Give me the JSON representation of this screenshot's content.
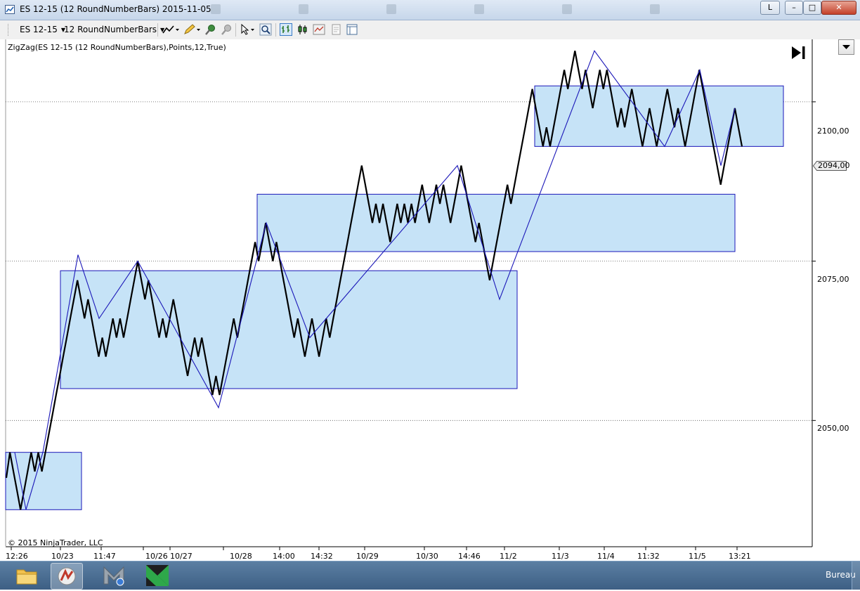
{
  "window": {
    "title": "ES 12-15  (12 RoundNumberBars)  2015-11-05",
    "background_tabs": [
      "",
      "",
      "",
      "",
      "",
      ""
    ],
    "buttons": {
      "l_label": "L",
      "minimize_label": "–",
      "maximize_label": "□",
      "close_label": "✕"
    }
  },
  "toolbar": {
    "instrument": "ES 12-15",
    "interval": "12 RoundNumberBars",
    "icons": [
      "line-drawing-icon",
      "pencil-icon",
      "magnet-icon",
      "crosshair-icon",
      "cursor-icon",
      "zoom-icon",
      "bar-style-icon",
      "candlestick-icon",
      "indicator-icon",
      "properties-icon",
      "layout-icon"
    ]
  },
  "chart": {
    "indicator_label": "ZigZag(ES 12-15 (12 RoundNumberBars),Points,12,True)",
    "copyright": "© 2015 NinjaTrader, LLC",
    "last_price": "2094,00",
    "y_ticks": [
      "2100,00",
      "2075,00",
      "2050,00"
    ],
    "x_ticks": [
      "12:26",
      "10/23",
      "11:47",
      "10/26",
      "10/27",
      "10/28",
      "14:00",
      "14:32",
      "10/29",
      "10/30",
      "14:46",
      "11/2",
      "11/3",
      "11/4",
      "11:32",
      "11/5",
      "13:21"
    ],
    "colors": {
      "price_line": "#000000",
      "zigzag_line": "#1b17b8",
      "box_fill": "#c6e3f7",
      "box_border": "#1b17b8",
      "grid": "#555555"
    }
  },
  "chart_data": {
    "type": "line",
    "title": "",
    "xlabel": "",
    "ylabel": "",
    "ylim": [
      2030.3,
      2109.8
    ],
    "y_ticks": [
      2100,
      2075,
      2050
    ],
    "last_price": 2094,
    "series": [
      {
        "values": [
          2041,
          2045,
          2042,
          2039,
          2036,
          2039,
          2042,
          2045,
          2042,
          2045,
          2042,
          2045,
          2048,
          2051,
          2054,
          2057,
          2060,
          2063,
          2066,
          2069,
          2072,
          2069,
          2066,
          2069,
          2066,
          2063,
          2060,
          2063,
          2060,
          2063,
          2066,
          2063,
          2066,
          2063,
          2066,
          2069,
          2072,
          2075,
          2072,
          2069,
          2072,
          2069,
          2066,
          2063,
          2066,
          2063,
          2066,
          2069,
          2066,
          2063,
          2060,
          2057,
          2060,
          2063,
          2060,
          2063,
          2060,
          2057,
          2054,
          2057,
          2054,
          2057,
          2060,
          2063,
          2066,
          2063,
          2066,
          2069,
          2072,
          2075,
          2078,
          2075,
          2078,
          2081,
          2078,
          2075,
          2078,
          2075,
          2072,
          2069,
          2066,
          2063,
          2066,
          2063,
          2060,
          2063,
          2066,
          2063,
          2060,
          2063,
          2066,
          2063,
          2066,
          2069,
          2072,
          2075,
          2078,
          2081,
          2084,
          2087,
          2090,
          2087,
          2084,
          2081,
          2084,
          2081,
          2084,
          2081,
          2078,
          2081,
          2084,
          2081,
          2084,
          2081,
          2084,
          2081,
          2084,
          2087,
          2084,
          2081,
          2084,
          2087,
          2084,
          2087,
          2084,
          2081,
          2084,
          2087,
          2090,
          2087,
          2084,
          2081,
          2078,
          2081,
          2078,
          2075,
          2072,
          2075,
          2078,
          2081,
          2084,
          2087,
          2084,
          2087,
          2090,
          2093,
          2096,
          2099,
          2102,
          2099,
          2096,
          2093,
          2096,
          2093,
          2096,
          2099,
          2102,
          2105,
          2102,
          2105,
          2108,
          2105,
          2102,
          2105,
          2102,
          2099,
          2102,
          2105,
          2102,
          2105,
          2102,
          2099,
          2096,
          2099,
          2096,
          2099,
          2102,
          2099,
          2096,
          2093,
          2096,
          2099,
          2096,
          2093,
          2096,
          2099,
          2102,
          2099,
          2096,
          2099,
          2096,
          2093,
          2096,
          2099,
          2102,
          2105,
          2102,
          2099,
          2096,
          2093,
          2090,
          2087,
          2090,
          2093,
          2096,
          2099,
          2096,
          2093
        ]
      },
      {
        "values": [
          2045,
          2036,
          2045,
          2076,
          2066,
          2075,
          2052,
          2081,
          2063,
          2090,
          2069,
          2108,
          2093,
          2105,
          2090,
          2099
        ]
      }
    ],
    "boxes": [
      {
        "low": 2036,
        "high": 2045
      },
      {
        "low": 2055,
        "high": 2073.5
      },
      {
        "low": 2076.5,
        "high": 2085.5
      },
      {
        "low": 2093,
        "high": 2102.5
      }
    ]
  }
}
